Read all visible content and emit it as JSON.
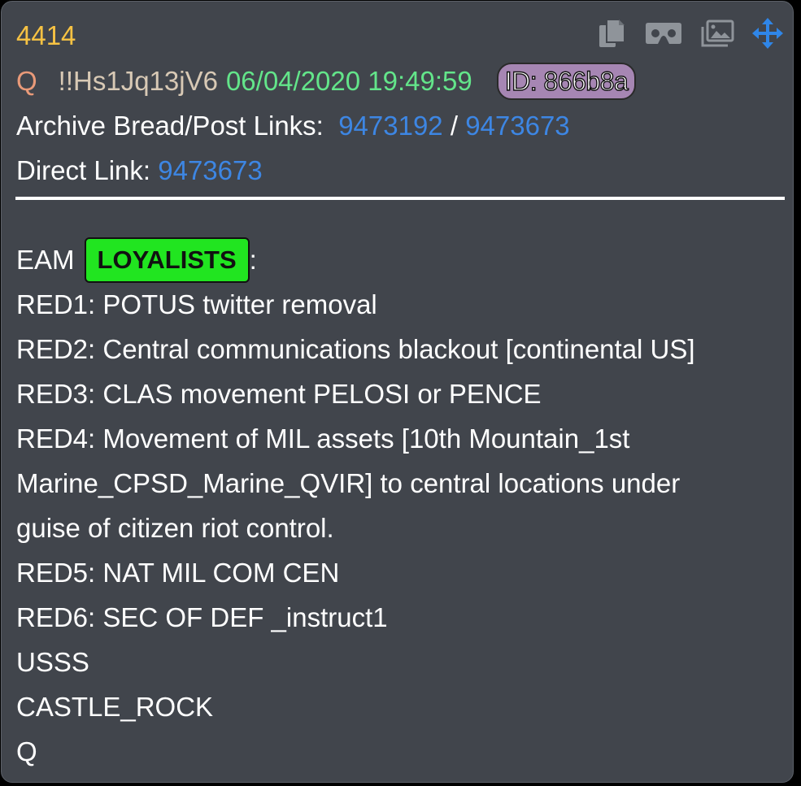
{
  "post": {
    "number": "4414",
    "author": "Q",
    "tripcode": "!!Hs1Jq13jV6",
    "timestamp": "06/04/2020 19:49:59",
    "id_badge": "ID: 866b8a",
    "archive_label": "Archive Bread/Post Links:",
    "archive_bread_link": "9473192",
    "separator": "/",
    "archive_post_link": "9473673",
    "direct_label": "Direct Link:",
    "direct_link": "9473673"
  },
  "toolbar": {
    "icons": [
      "copy-icon",
      "vr-goggles-icon",
      "image-gallery-icon",
      "move-arrows-icon"
    ],
    "icon_color": "#8f949a",
    "move_icon_color": "#2f86e8"
  },
  "body": {
    "eam_prefix": "EAM",
    "highlight": "LOYALISTS",
    "eam_suffix": ":",
    "lines": [
      "RED1: POTUS twitter removal",
      "RED2: Central communications blackout [continental US]",
      "RED3: CLAS movement PELOSI or PENCE",
      "RED4: Movement of MIL assets [10th Mountain_1st",
      "Marine_CPSD_Marine_QVIR] to central locations under",
      "guise of citizen riot control.",
      "RED5: NAT MIL COM CEN",
      "RED6: SEC OF DEF _instruct1",
      "USSS",
      "CASTLE_ROCK",
      "Q"
    ]
  },
  "colors": {
    "card_background": "#41454c",
    "post_number": "#f6c243",
    "author": "#e99a79",
    "timestamp": "#63e58a",
    "id_badge": "#a686b3",
    "link": "#3d86e3",
    "highlight": "#21e520"
  }
}
